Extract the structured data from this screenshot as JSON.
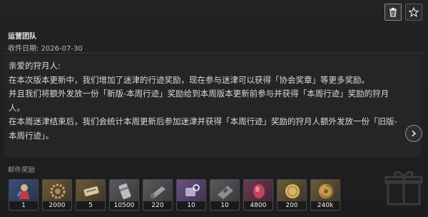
{
  "mail": {
    "sender": "运营团队",
    "date": "收件日期: 2026-07-30",
    "body": [
      "亲爱的狩月人:",
      "在本次版本更新中，我们增加了迷津的行迹奖励，现在参与迷津可以获得「协会奖章」等更多奖励。",
      "并且我们将额外发放一份「新版-本周行迹」奖励给到本周版本更新前参与并获得「本周行迹」奖励的狩月人。",
      "在本周迷津结束后，我们会统计本周更新后参加迷津并获得「本周行迹」奖励的狩月人额外发放一份「旧版-本周行迹」。"
    ]
  },
  "rewards": {
    "label": "邮件奖励",
    "items": [
      {
        "qty": "1",
        "icon": "figure-item-icon",
        "tint": "blue"
      },
      {
        "qty": "2000",
        "icon": "gear-material-icon",
        "tint": "gold"
      },
      {
        "qty": "5",
        "icon": "scroll-item-icon",
        "tint": "gold"
      },
      {
        "qty": "10500",
        "icon": "canister-item-icon",
        "tint": "grey"
      },
      {
        "qty": "220",
        "icon": "tool-item-icon",
        "tint": "grey"
      },
      {
        "qty": "10",
        "icon": "purple-tool-item-icon",
        "tint": "purple"
      },
      {
        "qty": "10",
        "icon": "device-item-icon",
        "tint": "grey"
      },
      {
        "qty": "4800",
        "icon": "red-gem-item-icon",
        "tint": "red"
      },
      {
        "qty": "200",
        "icon": "gold-coin-icon",
        "tint": "gold"
      },
      {
        "qty": "240k",
        "icon": "shell-coin-icon",
        "tint": "gold"
      }
    ]
  }
}
